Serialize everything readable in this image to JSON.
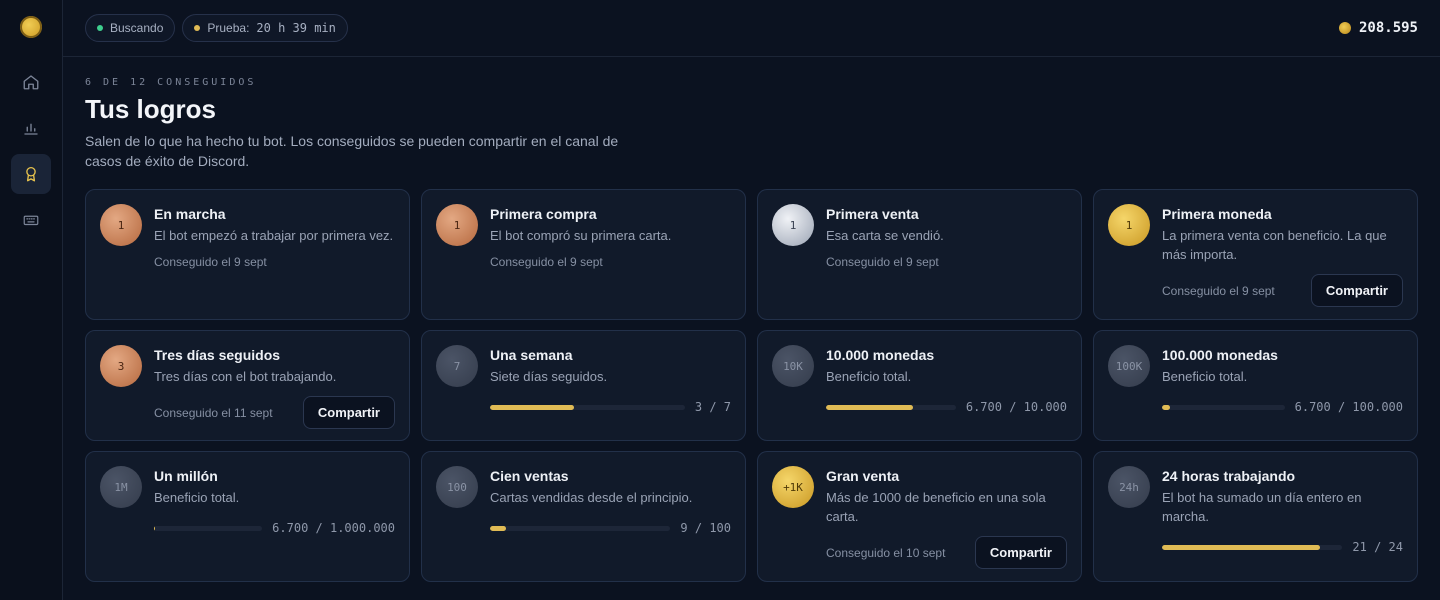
{
  "sidebar": {
    "items": [
      {
        "icon": "home-icon"
      },
      {
        "icon": "chart-icon"
      },
      {
        "icon": "award-icon",
        "active": true
      },
      {
        "icon": "keyboard-icon"
      }
    ]
  },
  "topbar": {
    "status_label": "Buscando",
    "status_color": "#3ecf8e",
    "trial_label": "Prueba:",
    "trial_value": "20 h 39 min",
    "trial_color": "#e0bb55",
    "balance": "208.595"
  },
  "header": {
    "eyebrow": "6 DE 12 CONSEGUIDOS",
    "title": "Tus logros",
    "subtitle": "Salen de lo que ha hecho tu bot. Los conseguidos se pueden compartir en el canal de casos de éxito de Discord."
  },
  "achievements": [
    {
      "medal": "1",
      "tier": "bronze",
      "title": "En marcha",
      "desc": "El bot empezó a trabajar por primera vez.",
      "achieved": "Conseguido el 9 sept"
    },
    {
      "medal": "1",
      "tier": "bronze",
      "title": "Primera compra",
      "desc": "El bot compró su primera carta.",
      "achieved": "Conseguido el 9 sept"
    },
    {
      "medal": "1",
      "tier": "silver",
      "title": "Primera venta",
      "desc": "Esa carta se vendió.",
      "achieved": "Conseguido el 9 sept"
    },
    {
      "medal": "1",
      "tier": "gold",
      "title": "Primera moneda",
      "desc": "La primera venta con beneficio. La que más importa.",
      "achieved": "Conseguido el 9 sept",
      "share": "Compartir"
    },
    {
      "medal": "3",
      "tier": "bronze",
      "title": "Tres días seguidos",
      "desc": "Tres días con el bot trabajando.",
      "achieved": "Conseguido el 11 sept",
      "share": "Compartir"
    },
    {
      "medal": "7",
      "tier": "locked",
      "title": "Una semana",
      "desc": "Siete días seguidos.",
      "progress_text": "3 / 7",
      "progress": 0.43
    },
    {
      "medal": "10K",
      "tier": "locked",
      "title": "10.000 monedas",
      "desc": "Beneficio total.",
      "progress_text": "6.700 / 10.000",
      "progress": 0.67
    },
    {
      "medal": "100K",
      "tier": "locked",
      "title": "100.000 monedas",
      "desc": "Beneficio total.",
      "progress_text": "6.700 / 100.000",
      "progress": 0.067
    },
    {
      "medal": "1M",
      "tier": "locked",
      "title": "Un millón",
      "desc": "Beneficio total.",
      "progress_text": "6.700 / 1.000.000",
      "progress": 0.0067
    },
    {
      "medal": "100",
      "tier": "locked",
      "title": "Cien ventas",
      "desc": "Cartas vendidas desde el principio.",
      "progress_text": "9 / 100",
      "progress": 0.09
    },
    {
      "medal": "+1K",
      "tier": "gold",
      "title": "Gran venta",
      "desc": "Más de 1000 de beneficio en una sola carta.",
      "achieved": "Conseguido el 10 sept",
      "share": "Compartir"
    },
    {
      "medal": "24h",
      "tier": "locked",
      "title": "24 horas trabajando",
      "desc": "El bot ha sumado un día entero en marcha.",
      "progress_text": "21 / 24",
      "progress": 0.875
    }
  ]
}
